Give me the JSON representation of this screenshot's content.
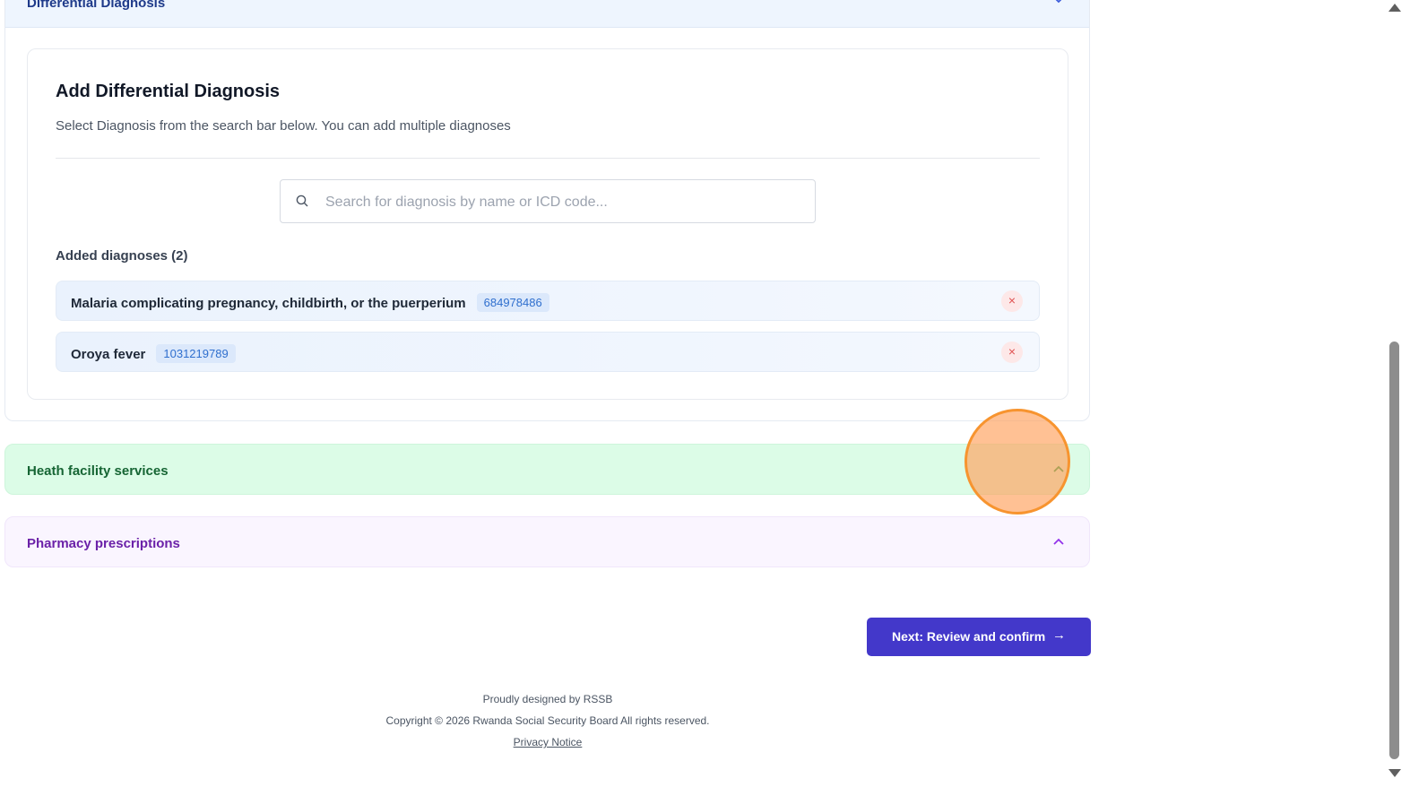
{
  "differential": {
    "accordion_title": "Differential Diagnosis",
    "card_title": "Add Differential Diagnosis",
    "card_subtitle": "Select Diagnosis from the search bar below. You can add multiple diagnoses",
    "search_placeholder": "Search for diagnosis by name or ICD code...",
    "search_value": "",
    "added_label": "Added diagnoses (2)",
    "diagnoses": [
      {
        "name": "Malaria complicating pregnancy, childbirth, or the puerperium",
        "code": "684978486",
        "remove": "×"
      },
      {
        "name": "Oroya fever",
        "code": "1031219789",
        "remove": "×"
      }
    ]
  },
  "sections": {
    "health_facility": "Heath facility services",
    "pharmacy": "Pharmacy prescriptions"
  },
  "actions": {
    "next_label": "Next: Review and confirm",
    "next_arrow": "→"
  },
  "footer": {
    "designed": "Proudly designed by RSSB",
    "copyright": "Copyright © 2026 Rwanda Social Security Board All rights reserved.",
    "privacy": "Privacy Notice"
  },
  "colors": {
    "primary": "#4338ca",
    "green_section": "#dcfce7",
    "purple_section": "#faf5ff",
    "diagnosis_code": "#2f6fce",
    "remove": "#e05252"
  },
  "icons": {
    "search": "search-icon",
    "chevron": "chevron-up-icon",
    "remove": "close-icon",
    "next": "arrow-right-icon"
  }
}
